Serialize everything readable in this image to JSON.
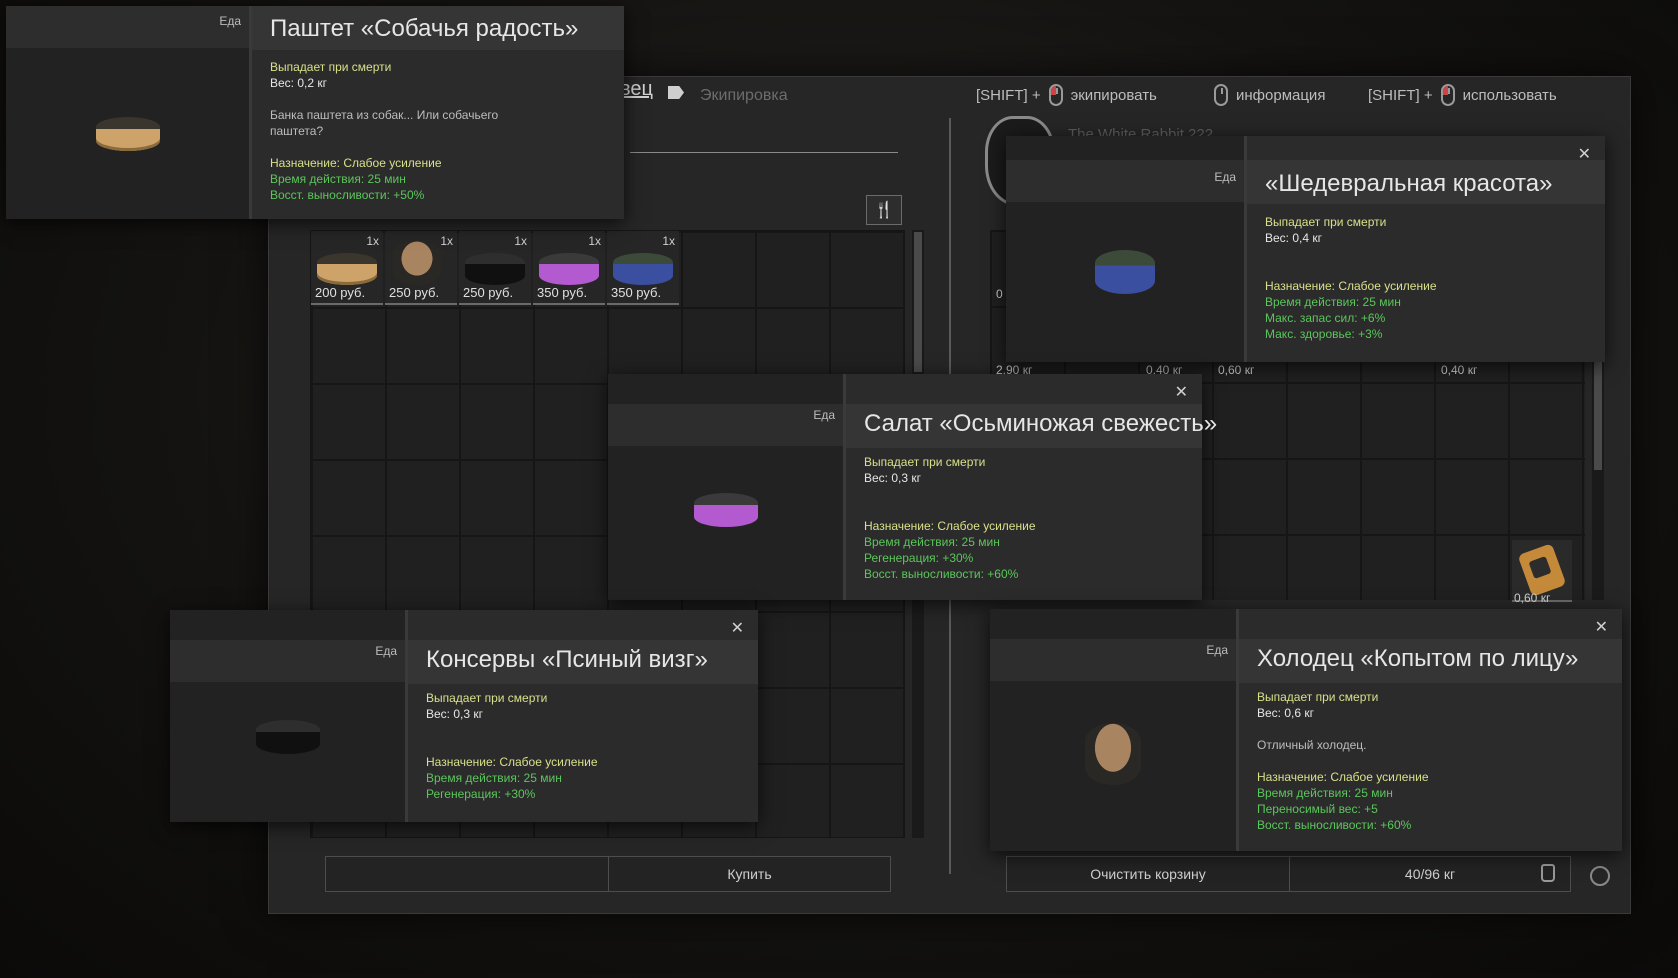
{
  "hints": {
    "equip_mod": "[SHIFT] +",
    "equip_label": "экипировать",
    "info_label": "информация",
    "use_mod": "[SHIFT] +",
    "use_label": "использовать"
  },
  "tabs": {
    "trader_fragment": "вец",
    "equipment": "Экипировка"
  },
  "trader": {
    "name_fragment": "The White Rabbit 222"
  },
  "shop_items": [
    {
      "qty": "1x",
      "price": "200 руб.",
      "can": "gold"
    },
    {
      "qty": "1x",
      "price": "250 руб.",
      "can": "jelly"
    },
    {
      "qty": "1x",
      "price": "250 руб.",
      "can": "black"
    },
    {
      "qty": "1x",
      "price": "350 руб.",
      "can": "pink"
    },
    {
      "qty": "1x",
      "price": "350 руб.",
      "can": "blue"
    }
  ],
  "inventory_weights": {
    "w1": "0",
    "w2": "2,90 кг",
    "w3": "0,40 кг",
    "w4": "0,60 кг",
    "w5": "0,40 кг",
    "w6": "0,60 кг"
  },
  "buttons": {
    "buy": "Купить",
    "clear_cart": "Очистить корзину",
    "weight": "40/96 кг"
  },
  "tooltips": {
    "pate": {
      "category": "Еда",
      "title": "Паштет «Собачья радость»",
      "drop": "Выпадает при смерти",
      "weight": "Вес: 0,2 кг",
      "desc": "Банка паштета из собак... Или собачьего паштета?",
      "purpose": "Назначение: Слабое усиление",
      "duration": "Время действия: 25 мин",
      "stat1": "Восст. выносливости: +50%"
    },
    "beauty": {
      "category": "Еда",
      "title": "«Шедевральная красота»",
      "drop": "Выпадает при смерти",
      "weight": "Вес: 0,4 кг",
      "purpose": "Назначение: Слабое усиление",
      "duration": "Время действия: 25 мин",
      "stat1": "Макс. запас сил: +6%",
      "stat2": "Макс. здоровье: +3%"
    },
    "salad": {
      "category": "Еда",
      "title": "Салат «Осьминожая свежесть»",
      "drop": "Выпадает при смерти",
      "weight": "Вес: 0,3 кг",
      "purpose": "Назначение: Слабое усиление",
      "duration": "Время действия: 25 мин",
      "stat1": "Регенерация: +30%",
      "stat2": "Восст. выносливости: +60%"
    },
    "canned": {
      "category": "Еда",
      "title": "Консервы «Псиный визг»",
      "drop": "Выпадает при смерти",
      "weight": "Вес: 0,3 кг",
      "purpose": "Назначение: Слабое усиление",
      "duration": "Время действия: 25 мин",
      "stat1": "Регенерация: +30%"
    },
    "jelly": {
      "category": "Еда",
      "title": "Холодец «Копытом по лицу»",
      "drop": "Выпадает при смерти",
      "weight": "Вес: 0,6 кг",
      "desc": "Отличный холодец.",
      "purpose": "Назначение: Слабое усиление",
      "duration": "Время действия: 25 мин",
      "stat1": "Переносимый вес: +5",
      "stat2": "Восст. выносливости: +60%"
    }
  },
  "close_glyph": "✕"
}
